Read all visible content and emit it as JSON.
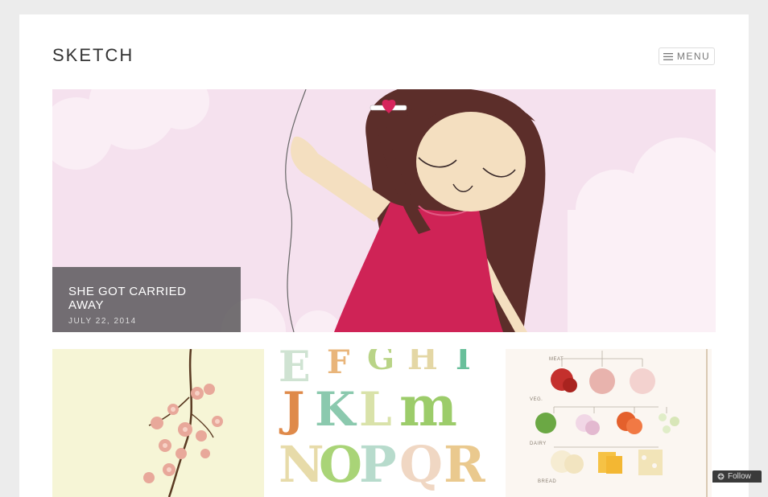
{
  "site": {
    "title": "SKETCH"
  },
  "menu": {
    "label": "MENU",
    "icon": "hamburger-icon"
  },
  "featured": {
    "title": "SHE GOT CARRIED AWAY",
    "date": "JULY 22, 2014"
  },
  "food_chart": {
    "labels": [
      "MEAT",
      "VEG.",
      "DAIRY",
      "BREAD"
    ]
  },
  "follow": {
    "label": "Follow",
    "icon": "plus-circle-icon"
  },
  "colors": {
    "background": "#ececec",
    "page": "#ffffff",
    "hero_bg": "#f5e1ee",
    "dress": "#cf2356",
    "hair": "#5c2e2a",
    "caption_bg": "#646064"
  }
}
